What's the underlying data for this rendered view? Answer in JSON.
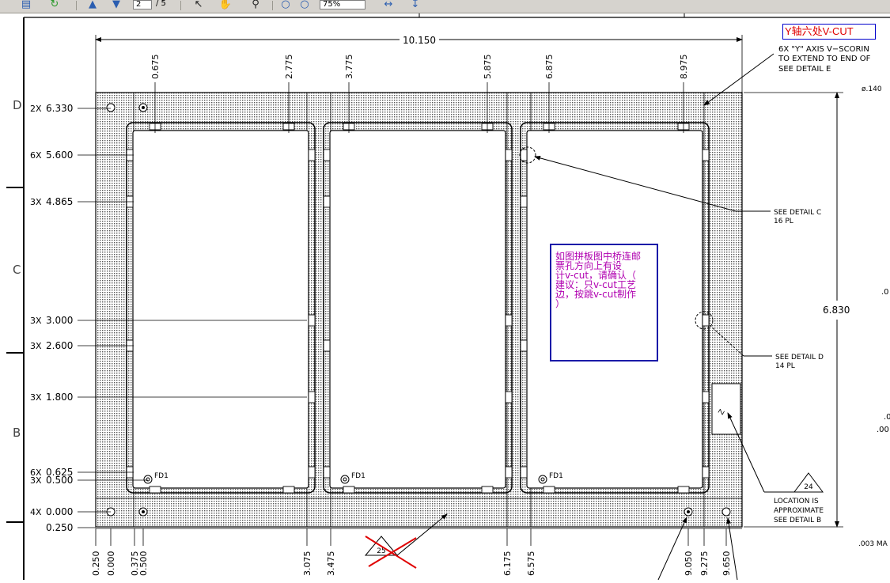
{
  "toolbar": {
    "page_current": "2",
    "page_total": "/ 5",
    "zoom": "75%",
    "icons": [
      "document-icon",
      "refresh-icon",
      "arrow-up-icon",
      "arrow-down-icon",
      "select-tool-icon",
      "hand-tool-icon",
      "zoom-icon",
      "rotate-icon",
      "fit-width-icon",
      "fit-page-icon"
    ]
  },
  "drawing": {
    "overall_width": "10.150",
    "overall_height": "6.830",
    "hole_dia": "ø.140",
    "zone_letters": [
      {
        "label": "D"
      },
      {
        "label": "C"
      },
      {
        "label": "B"
      }
    ],
    "top_dims": [
      "0.675",
      "2.775",
      "3.775",
      "5.875",
      "6.875",
      "8.975"
    ],
    "bottom_dims": [
      "0.250",
      "0.000",
      "0.375",
      "0.500",
      "3.075",
      "3.475",
      "6.175",
      "6.575",
      "9.050",
      "9.275",
      "9.650"
    ],
    "left_dims": [
      {
        "count": "2X",
        "value": "6.330"
      },
      {
        "count": "6X",
        "value": "5.600"
      },
      {
        "count": "3X",
        "value": "4.865"
      },
      {
        "count": "3X",
        "value": "3.000"
      },
      {
        "count": "3X",
        "value": "2.600"
      },
      {
        "count": "3X",
        "value": "1.800"
      },
      {
        "count": "6X",
        "value": "0.625"
      },
      {
        "count": "3X",
        "value": "0.500"
      },
      {
        "count": "4X",
        "value": "0.000"
      },
      {
        "count": "",
        "value": "0.250"
      }
    ],
    "fiducial_label": "FD1",
    "vscore_note": [
      "6X \"Y\" AXIS V−SCORIN",
      "TO EXTEND TO END OF",
      "SEE DETAIL E"
    ],
    "detail_c": [
      "SEE DETAIL C",
      "16 PL"
    ],
    "detail_d": [
      "SEE DETAIL D",
      "14 PL"
    ],
    "location_note": [
      "LOCATION IS",
      "APPROXIMATE",
      "SEE DETAIL B"
    ],
    "triangle_24": "24",
    "triangle_25": "25",
    "right_fragments": [
      ".0",
      ".0",
      ".00",
      ".003 MA"
    ],
    "y_axis_title": "Y轴六处V-CUT",
    "note_lines": [
      "如图拼板图中桥连邮",
      "票孔方向上有设",
      "计v-cut，请确认（",
      "建议：只v-cut工艺",
      "边，按跳v-cut制作",
      "）"
    ],
    "colors": {
      "accent_note": "#b000b0",
      "note_border": "#1a1aa8",
      "cross_out": "#e00000",
      "board_fill": "#d8d8d8"
    }
  }
}
